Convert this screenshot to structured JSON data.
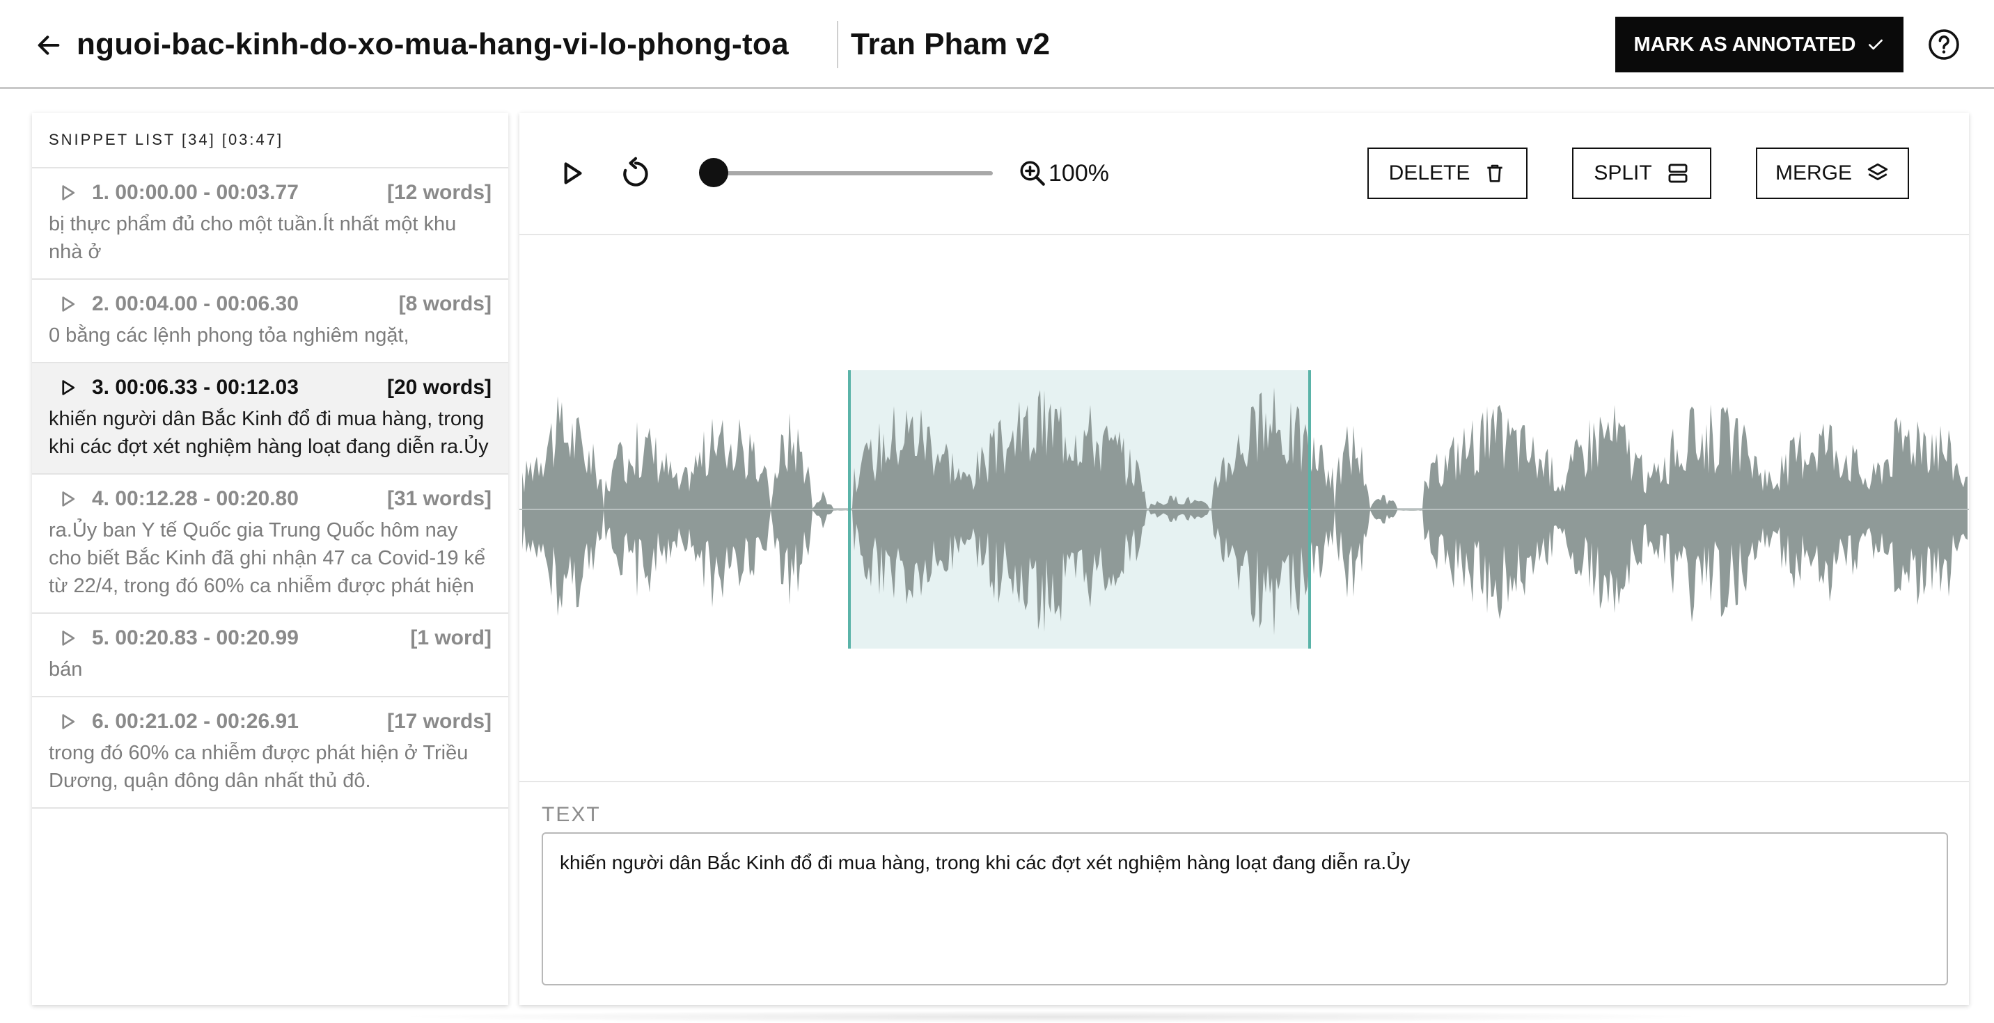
{
  "header": {
    "title": "nguoi-bac-kinh-do-xo-mua-hang-vi-lo-phong-toa",
    "annotator": "Tran Pham v2",
    "mark_label": "MARK AS ANNOTATED"
  },
  "snippets": {
    "header": "SNIPPET LIST [34] [03:47]",
    "items": [
      {
        "range": "1. 00:00.00 - 00:03.77",
        "words": "[12 words]",
        "text": "bị thực phẩm đủ cho một tuần.Ít nhất một khu nhà ở"
      },
      {
        "range": "2. 00:04.00 - 00:06.30",
        "words": "[8 words]",
        "text": "0 bằng các lệnh phong tỏa nghiêm ngặt,"
      },
      {
        "range": "3. 00:06.33 - 00:12.03",
        "words": "[20 words]",
        "text": "khiến người dân Bắc Kinh đổ đi mua hàng, trong khi các đợt xét nghiệm hàng loạt đang diễn ra.Ủy"
      },
      {
        "range": "4. 00:12.28 - 00:20.80",
        "words": "[31 words]",
        "text": "ra.Ủy ban Y tế Quốc gia Trung Quốc hôm nay cho biết Bắc Kinh đã ghi nhận 47 ca Covid-19 kể từ 22/4, trong đó 60% ca nhiễm được phát hiện"
      },
      {
        "range": "5. 00:20.83 - 00:20.99",
        "words": "[1 word]",
        "text": "bán"
      },
      {
        "range": "6. 00:21.02 - 00:26.91",
        "words": "[17 words]",
        "text": "trong đó 60% ca nhiễm được phát hiện ở Triều Dương, quận đông dân nhất thủ đô."
      }
    ]
  },
  "toolbar": {
    "zoom": "100%",
    "delete_label": "DELETE",
    "split_label": "SPLIT",
    "merge_label": "MERGE",
    "playback_position": 0
  },
  "editor": {
    "text_label": "TEXT",
    "text_value": "khiến người dân Bắc Kinh đổ đi mua hàng, trong khi các đợt xét nghiệm hàng loạt đang diễn ra.Ủy"
  },
  "colors": {
    "waveform": "#8f9a98",
    "selection_fill": "#e6f2f2",
    "selection_edge": "#5ab3a8",
    "primary": "#0a0a0a"
  }
}
